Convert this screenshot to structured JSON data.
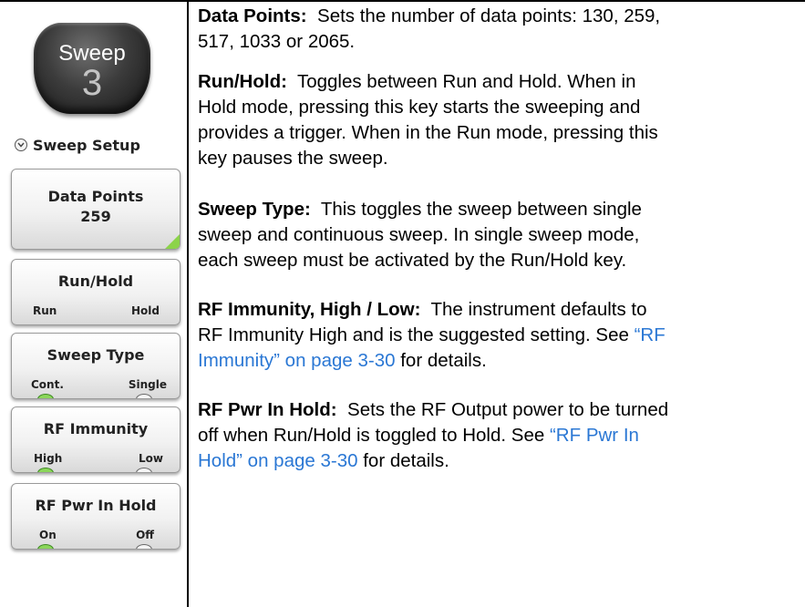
{
  "hardkey": {
    "name": "Sweep",
    "number": "3",
    "icon": "hardkey-button"
  },
  "menu": {
    "title": "Sweep Setup",
    "icon": "chevron-down-circle-icon",
    "softkeys": [
      {
        "label": "Data Points",
        "value": "259",
        "submenu": true
      },
      {
        "label": "Run/Hold",
        "options": [
          "Run",
          "Hold"
        ],
        "active": "Run"
      },
      {
        "label": "Sweep Type",
        "options": [
          "Cont.",
          "Single"
        ],
        "active": "Cont."
      },
      {
        "label": "RF Immunity",
        "options": [
          "High",
          "Low"
        ],
        "active": "High"
      },
      {
        "label": "RF Pwr In Hold",
        "options": [
          "On",
          "Off"
        ],
        "active": "On"
      }
    ],
    "colors": {
      "led_on": "#8bd65a",
      "submenu_arrow": "#8cd34a"
    }
  },
  "descriptions": [
    {
      "term": "Data Points:",
      "lines": [
        "Sets the number of data points: 130, 259,",
        "517, 1033 or 2065."
      ]
    },
    {
      "term": "Run/Hold:",
      "lines": [
        "Toggles between Run and Hold. When in",
        "Hold mode, pressing this key starts the sweeping and",
        "provides a trigger. When in the Run mode, pressing this",
        "key pauses the sweep."
      ]
    },
    {
      "term": "Sweep Type:",
      "lines": [
        "This toggles the sweep between single",
        "sweep and continuous sweep. In single sweep mode,",
        "each sweep must be activated by the Run/Hold key."
      ]
    },
    {
      "term": "RF Immunity, High / Low:",
      "line1_rest": "The instrument defaults to",
      "line2": "RF Immunity High and is the suggested setting. See",
      "xref_part1": "“RF",
      "xref_part2": "Immunity” on page 3-30",
      "tail": "for details."
    },
    {
      "term": "RF Pwr In Hold:",
      "line1_rest": "Sets the RF Output power to be turned",
      "line2_pre": "off when Run/Hold is toggled to Hold. See",
      "xref_part1": "“RF Pwr In",
      "xref_part2": "Hold” on page 3-30",
      "tail": "for details."
    }
  ],
  "xref_color": "#2a77d4"
}
